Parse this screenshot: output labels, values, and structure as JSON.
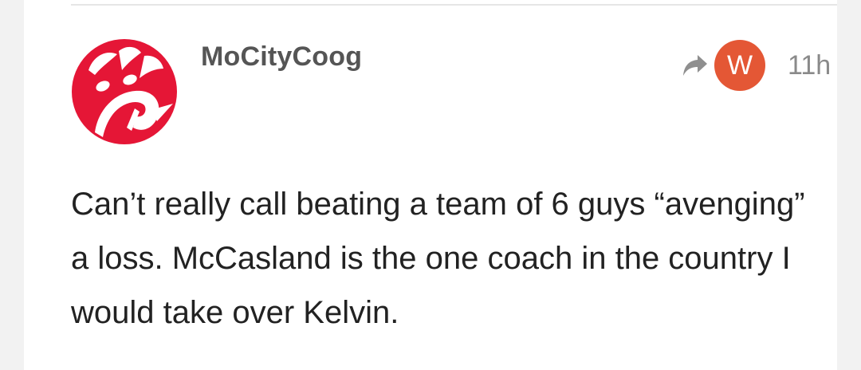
{
  "post": {
    "username": "MoCityCoog",
    "badge_letter": "W",
    "time": "11h",
    "body": "Can’t really call beating a team of 6 guys “avenging” a loss. McCasland is the one coach in the country I would take over Kelvin."
  },
  "colors": {
    "avatar_red": "#e51636",
    "badge_bg": "#e45735",
    "username": "#555555",
    "meta_text": "#8a8a8a",
    "body_text": "#222222"
  },
  "icons": {
    "avatar": "red-circle-logo-avatar",
    "reply": "reply-arrow-icon"
  }
}
